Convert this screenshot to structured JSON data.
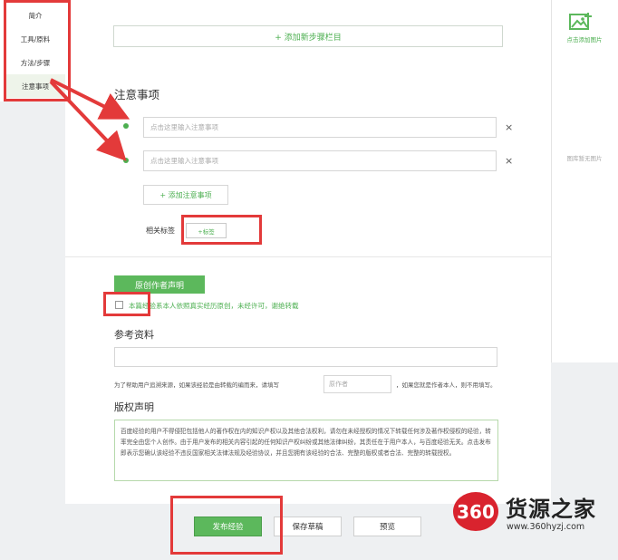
{
  "sidebar": {
    "items": [
      {
        "label": "简介"
      },
      {
        "label": "工具/原料"
      },
      {
        "label": "方法/步骤"
      },
      {
        "label": "注意事项"
      }
    ]
  },
  "steps": {
    "add_step_label": "+ 添加新步骤栏目"
  },
  "notes": {
    "title": "注意事项",
    "inputs": [
      {
        "placeholder": "点击这里输入注意事项"
      },
      {
        "placeholder": "点击这里输入注意事项"
      }
    ],
    "remove_icon": "×",
    "add_label": "+ 添加注意事项"
  },
  "tags": {
    "label": "相关标签",
    "add_label": "+标签"
  },
  "original": {
    "banner": "原创作者声明",
    "checkbox_label": "本篇经验系本人依照真实经历原创，未经许可，谢绝转载",
    "checked": false
  },
  "references": {
    "title": "参考资料",
    "help_before": "为了帮助用户追溯来源，如果该经验是由转载的编而来，请填写",
    "original_author_placeholder": "原作者",
    "help_after": "，如果您就是作者本人，则不用填写。"
  },
  "copyright": {
    "title": "版权声明",
    "text": "百度经验的用户不得侵犯包括他人的著作权在内的知识产权以及其他合法权利，请勿在未经授权的情况下转载任何涉及著作权侵权的经验，转率完全由您个人创作。由于用户发布的相关内容引起的任何知识产权纠纷或其他法律纠纷，其责任在于用户本人，与百度经验无关。点击发布即表示您确认该经验不违反国家相关法律法规及经验协议，并且您拥有该经验的合法、完整的版权或者合法、完整的转载授权。"
  },
  "actions": {
    "publish": "发布经验",
    "save_draft": "保存草稿",
    "preview": "预览"
  },
  "right_panel": {
    "add_image": "点击添加图片",
    "library_empty": "图库暂无图片"
  },
  "watermark": {
    "badge": "360",
    "name": "货源之家",
    "url": "www.360hyzj.com"
  },
  "colors": {
    "accent": "#5cb85c",
    "annotation": "#e33a3a"
  }
}
